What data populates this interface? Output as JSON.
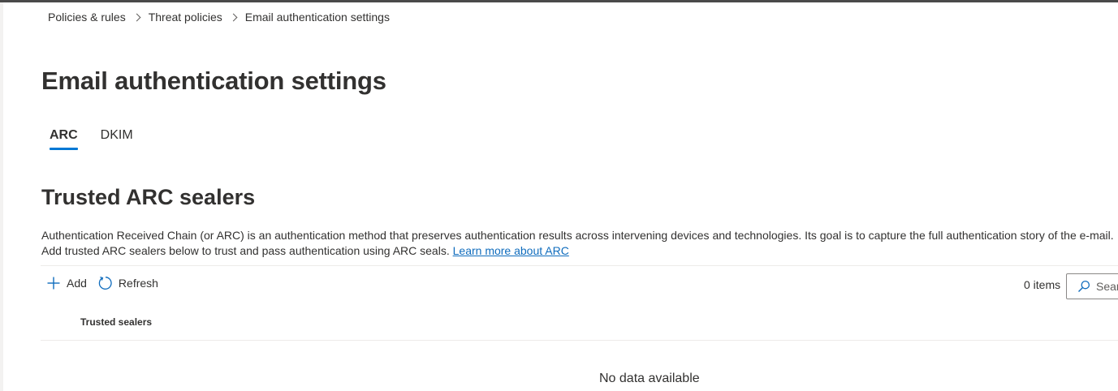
{
  "breadcrumb": {
    "items": [
      "Policies & rules",
      "Threat policies",
      "Email authentication settings"
    ]
  },
  "page": {
    "title": "Email authentication settings"
  },
  "tabs": [
    {
      "label": "ARC",
      "active": true
    },
    {
      "label": "DKIM",
      "active": false
    }
  ],
  "section": {
    "title": "Trusted ARC sealers",
    "description_line1": "Authentication Received Chain (or ARC) is an authentication method that preserves authentication results across intervening devices and technologies. Its goal is to capture the full authentication story of the e-mail.",
    "description_line2": "Add trusted ARC sealers below to trust and pass authentication using ARC seals.",
    "learn_more_link": "Learn more about ARC"
  },
  "toolbar": {
    "add_label": "Add",
    "add_icon": "plus-icon",
    "refresh_label": "Refresh",
    "refresh_icon": "refresh-icon",
    "items_count": "0 items",
    "search_placeholder": "Sear",
    "search_icon": "search-icon"
  },
  "table": {
    "columns": [
      "Trusted sealers"
    ],
    "rows": [],
    "empty_message": "No data available"
  },
  "colors": {
    "accent": "#0078d4",
    "link": "#0f6cbd",
    "text": "#323130"
  }
}
